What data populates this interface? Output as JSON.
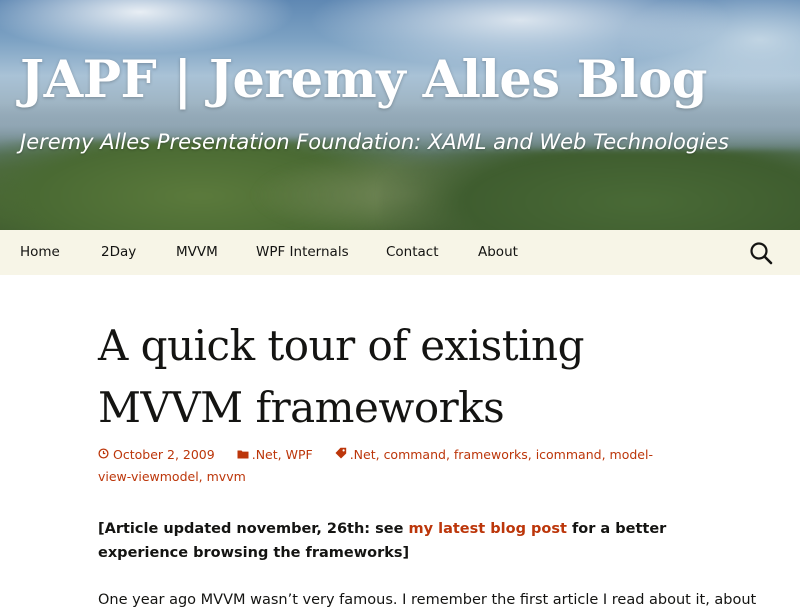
{
  "header": {
    "title": "JAPF | Jeremy Alles Blog",
    "description": "Jeremy Alles Presentation Foundation: XAML and Web Technologies"
  },
  "nav": {
    "items": [
      "Home",
      "2Day",
      "MVVM",
      "WPF Internals",
      "Contact",
      "About"
    ],
    "search_icon": "search-icon"
  },
  "post": {
    "title": "A quick tour of existing MVVM frameworks",
    "date": "October 2, 2009",
    "categories": [
      ".Net",
      "WPF"
    ],
    "tags": [
      ".Net",
      "command",
      "frameworks",
      "icommand",
      "model-view-viewmodel",
      "mvvm"
    ],
    "note_before": "[Article updated november, 26th: see ",
    "note_link": "my latest blog post",
    "note_after": " for a better experience browsing the frameworks]",
    "intro": "One year ago MVVM wasn’t very famous. I remember the first article I read about it, about"
  },
  "colors": {
    "accent": "#bc360a",
    "nav_bg": "#f7f5e7",
    "text": "#141412"
  }
}
